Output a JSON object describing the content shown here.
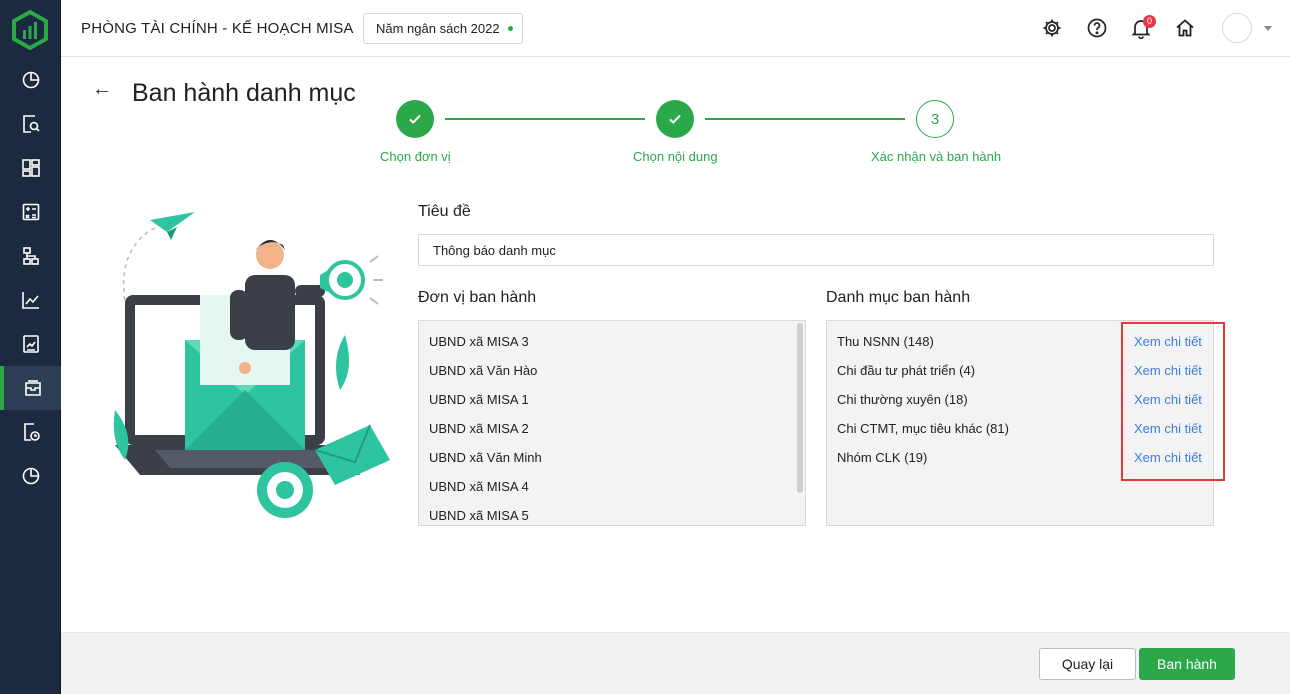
{
  "colors": {
    "sidebar": "#1c2a3f",
    "accent": "#2ba84a",
    "link": "#3b7ddd",
    "highlight": "#e53935",
    "badge": "#e5364a"
  },
  "sidebar": {
    "logo_icon": "misa-logo-icon",
    "items": [
      {
        "icon": "pie-chart-icon"
      },
      {
        "icon": "document-search-icon"
      },
      {
        "icon": "dashboard-grid-icon"
      },
      {
        "icon": "calculator-icon"
      },
      {
        "icon": "org-chart-icon"
      },
      {
        "icon": "line-chart-icon"
      },
      {
        "icon": "report-icon"
      },
      {
        "icon": "inbox-archive-icon",
        "active": true
      },
      {
        "icon": "document-clock-icon"
      },
      {
        "icon": "pie-chart-icon"
      }
    ]
  },
  "header": {
    "app_title": "PHÒNG TÀI CHÍNH - KẾ HOẠCH MISA",
    "budget_year": "Năm ngân sách 2022",
    "notification_count": "0",
    "icons": [
      "gear-icon",
      "help-icon",
      "bell-icon",
      "home-icon"
    ]
  },
  "page": {
    "back_icon": "←",
    "title": "Ban hành danh mục"
  },
  "stepper": {
    "steps": [
      {
        "label": "Chọn đơn vị",
        "state": "done",
        "number": ""
      },
      {
        "label": "Chọn nội dung",
        "state": "done",
        "number": ""
      },
      {
        "label": "Xác nhận và ban hành",
        "state": "current",
        "number": "3"
      }
    ]
  },
  "form": {
    "title_label": "Tiêu đề",
    "title_value": "Thông báo danh mục",
    "units_label": "Đơn vị ban hành",
    "units": [
      "UBND xã MISA 3",
      "UBND xã Văn Hào",
      "UBND xã MISA 1",
      "UBND xã MISA 2",
      "UBND xã Văn Minh",
      "UBND xã MISA 4",
      "UBND xã MISA 5"
    ],
    "categories_label": "Danh mục ban hành",
    "categories": [
      {
        "name": "Thu NSNN (148)",
        "link": "Xem chi tiết"
      },
      {
        "name": "Chi đầu tư phát triển (4)",
        "link": "Xem chi tiết"
      },
      {
        "name": "Chi thường xuyên (18)",
        "link": "Xem chi tiết"
      },
      {
        "name": "Chi CTMT, mục tiêu khác (81)",
        "link": "Xem chi tiết"
      },
      {
        "name": "Nhóm CLK (19)",
        "link": "Xem chi tiết"
      }
    ]
  },
  "footer": {
    "back_label": "Quay lại",
    "issue_label": "Ban hành"
  }
}
